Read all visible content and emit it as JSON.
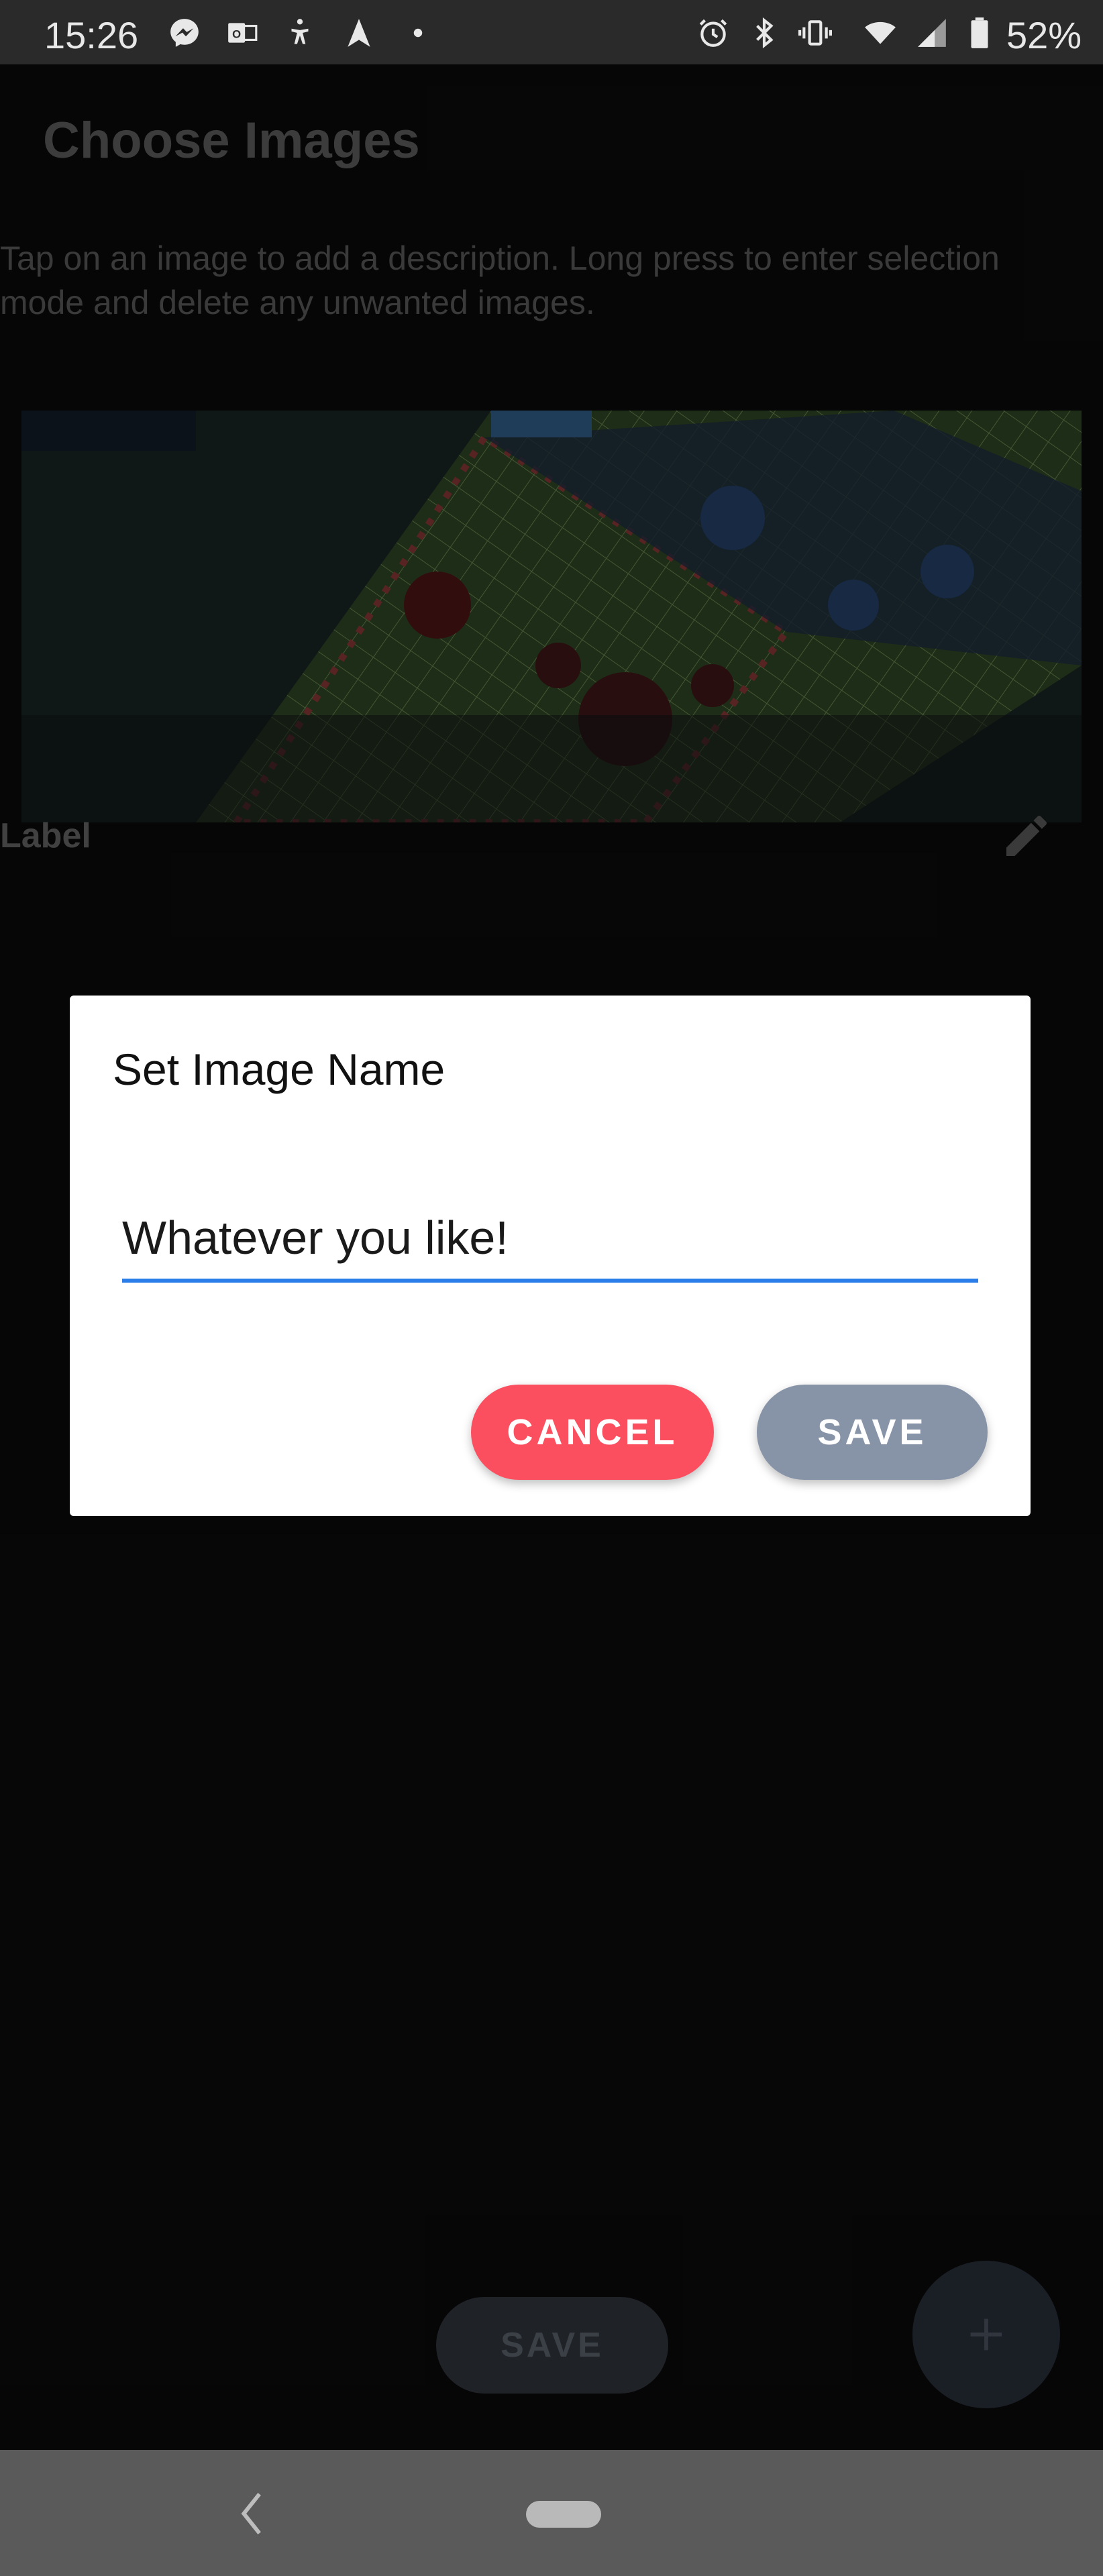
{
  "status_bar": {
    "time": "15:26",
    "battery_percent": "52%",
    "notification_icons": [
      "messenger-icon",
      "outlook-icon",
      "accessibility-icon",
      "navigation-arrow-icon",
      "dot-icon"
    ],
    "system_icons": [
      "alarm-icon",
      "bluetooth-icon",
      "vibrate-icon",
      "wifi-icon",
      "signal-icon",
      "battery-icon"
    ]
  },
  "screen": {
    "title": "Choose Images",
    "description": "Tap on an image to add a description. Long press to enter selection mode and delete any unwanted images.",
    "image_card": {
      "label": "Label"
    },
    "save_button": "SAVE"
  },
  "dialog": {
    "title": "Set Image Name",
    "input_value": "Whatever you like!",
    "cancel_label": "CANCEL",
    "save_label": "SAVE"
  },
  "colors": {
    "accent_input": "#2b7de9",
    "cancel": "#fb4f60",
    "save": "#8794a8"
  }
}
